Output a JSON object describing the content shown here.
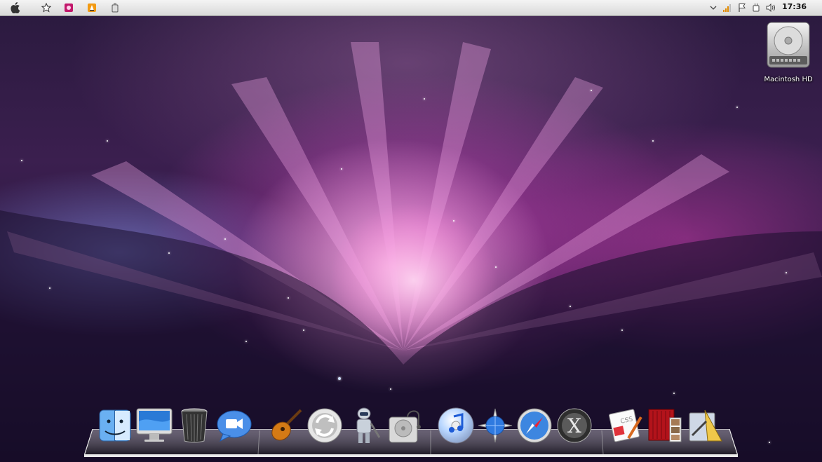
{
  "menubar": {
    "clock": "17:36",
    "left_icons": [
      "apple-logo-icon",
      "star-icon",
      "flower-app-icon",
      "vlc-cone-icon",
      "usb-drive-icon"
    ],
    "right_icons": [
      "chevron-down-icon",
      "signal-bars-icon",
      "flag-icon",
      "power-plug-icon",
      "speaker-icon"
    ]
  },
  "desktop": {
    "icons": [
      {
        "label": "Macintosh HD",
        "icon": "hard-drive-icon"
      }
    ]
  },
  "dock": {
    "items": [
      {
        "name": "finder",
        "icon": "finder-icon"
      },
      {
        "name": "imac",
        "icon": "imac-display-icon"
      },
      {
        "name": "trash",
        "icon": "trash-can-icon"
      },
      {
        "name": "ichat",
        "icon": "video-chat-bubble-icon"
      },
      {
        "name": "garageband",
        "icon": "guitar-icon"
      },
      {
        "name": "sync",
        "icon": "sync-arrows-icon"
      },
      {
        "name": "automator",
        "icon": "automator-robot-icon"
      },
      {
        "name": "disk-utility",
        "icon": "disk-utility-icon"
      },
      {
        "name": "itunes",
        "icon": "itunes-cd-icon"
      },
      {
        "name": "network",
        "icon": "compass-globe-icon"
      },
      {
        "name": "safari",
        "icon": "safari-compass-icon"
      },
      {
        "name": "mac-os-x",
        "icon": "mac-os-x-icon"
      },
      {
        "name": "css-editor",
        "icon": "css-editor-icon"
      },
      {
        "name": "photo-booth",
        "icon": "photo-booth-icon"
      },
      {
        "name": "xcode-tools",
        "icon": "drafting-tools-icon"
      }
    ]
  }
}
